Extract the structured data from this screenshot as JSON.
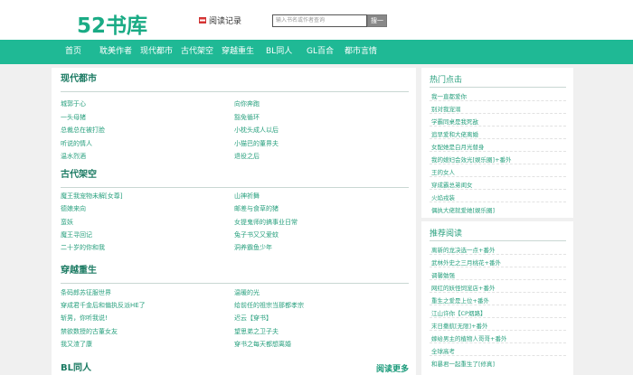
{
  "header": {
    "logo": "52书库",
    "history_label": "阅读记录",
    "search_placeholder": "输入书名或作者查询",
    "search_button": "搜一下"
  },
  "nav": [
    "首页",
    "耽美作者",
    "现代都市",
    "古代架空",
    "穿越重生",
    "BL同人",
    "GL百合",
    "都市言情"
  ],
  "sections": [
    {
      "title": "现代都市",
      "books": [
        [
          "城郭于心",
          "向你奔跑"
        ],
        [
          "一头母猪",
          "豁免循环"
        ],
        [
          "总裁总在被打脸",
          "小枕头成人以后"
        ],
        [
          "听说的情人",
          "小猫巴的董界夫"
        ],
        [
          "温水烈酒",
          "退役之后"
        ]
      ]
    },
    {
      "title": "古代架空",
      "books": [
        [
          "魔王我宠物未解[女尊]",
          "山神祈舞"
        ],
        [
          "德娘来向",
          "邮差与食草的猪"
        ],
        [
          "蛮妖",
          "女提鬼师的搞事业日常"
        ],
        [
          "魔王寻回记",
          "兔子书又又爱蚊"
        ],
        [
          "二十岁的你和我",
          "洞养霸鱼少年"
        ]
      ]
    },
    {
      "title": "穿越重生",
      "books": [
        [
          "条码郎苏征服世界",
          "温暖的光"
        ],
        [
          "穿成君千金后和偏执反派HE了",
          "给前任的祖宗当那都孝宗"
        ],
        [
          "斩男，你听我说!",
          "迟云【穿书】"
        ],
        [
          "禁欲数授的古董女友",
          "望思弟之卫子夫"
        ],
        [
          "我又渣了康",
          "穿书之每天都想离婚"
        ]
      ]
    },
    {
      "title": "BL同人",
      "books": [],
      "more": "阅读更多"
    }
  ],
  "sidebar": {
    "hot": {
      "title": "热门点击",
      "items": [
        "我一直都爱你",
        "别对我宠溺",
        "学霸同桌是我死敌",
        "追早爱和大佬离婚",
        "女配她是白月光替身",
        "我的媳妇会效光[娱乐圈]+番外",
        "王的女人",
        "穿成霸总弟闺女",
        "火焰戎装",
        "偶执大佬就爱她[娱乐圈]"
      ]
    },
    "recommend": {
      "title": "推荐阅读",
      "items": [
        "离新的龙决选一点+番外",
        "武林外史之三月桃花+番外",
        "调馨勉强",
        "网红的妖怪饲宠店+番外",
        "重生之爱是上位+番外",
        "江山许你【CP烟路】",
        "末日撒航[无限]+番外",
        "嫁给男主的植物人哥哥+番外",
        "全球高考",
        "和暴君一起重生了[修真]"
      ]
    }
  }
}
